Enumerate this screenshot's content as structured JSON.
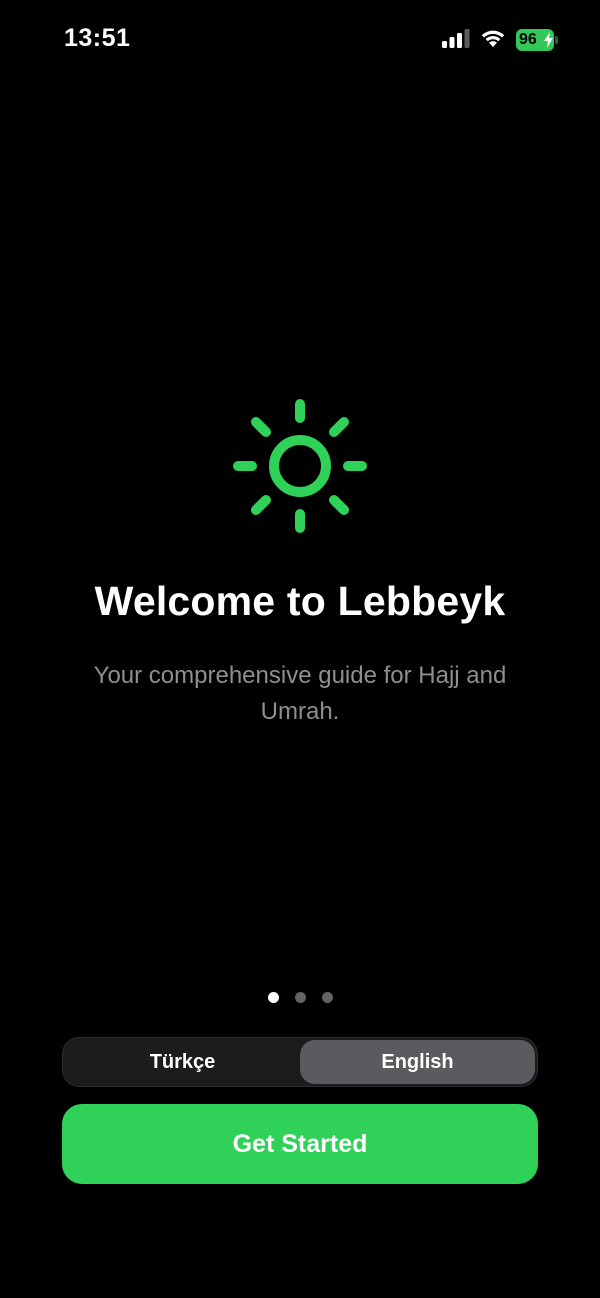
{
  "status_bar": {
    "time": "13:51",
    "battery_level": "96",
    "battery_color": "#34c759"
  },
  "hero": {
    "icon": "sun-icon",
    "accent_color": "#30d158",
    "title": "Welcome to Lebbeyk",
    "subtitle": "Your comprehensive guide for Hajj and Umrah."
  },
  "pager": {
    "page_count": 3,
    "current_page": 1
  },
  "language_toggle": {
    "options": [
      "Türkçe",
      "English"
    ],
    "selected": "English"
  },
  "primary_button": {
    "label": "Get Started"
  }
}
